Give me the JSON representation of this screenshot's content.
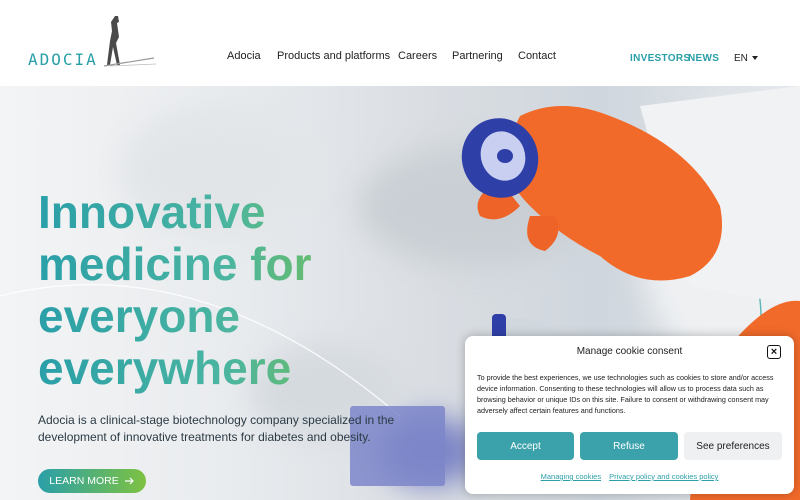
{
  "header": {
    "logo_text": "ADOCIA",
    "nav": [
      {
        "label": "Adocia"
      },
      {
        "label": "Products and platforms"
      },
      {
        "label": "Careers"
      },
      {
        "label": "Partnering"
      },
      {
        "label": "Contact"
      }
    ],
    "investors": "INVESTORS",
    "news": "NEWS",
    "language": "EN"
  },
  "hero": {
    "title_lines": [
      "Innovative",
      "medicine for",
      "everyone",
      "everywhere"
    ],
    "description": "Adocia is a clinical-stage biotechnology company specialized in the development of innovative treatments for diabetes and obesity.",
    "cta": "LEARN MORE",
    "cta_icon": "arrow-right-icon"
  },
  "cookie": {
    "title": "Manage cookie consent",
    "close_icon": "close-icon",
    "text": "To provide the best experiences, we use technologies such as cookies to store and/or access device information. Consenting to these technologies will allow us to process data such as browsing behavior or unique IDs on this site. Failure to consent or withdrawing consent may adversely affect certain features and functions.",
    "accept": "Accept",
    "refuse": "Refuse",
    "preferences": "See preferences",
    "links": [
      "Managing cookies",
      "Privacy policy and cookies policy"
    ]
  },
  "colors": {
    "teal": "#2a9fa8",
    "green": "#7ec242",
    "button_teal": "#3ba2ab"
  }
}
